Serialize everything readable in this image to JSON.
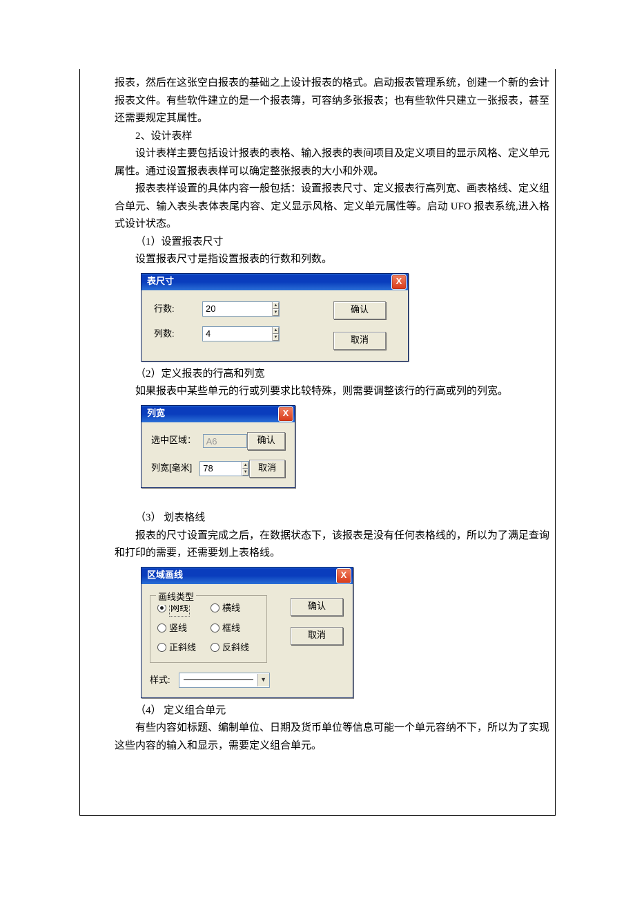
{
  "text": {
    "p1": "报表，然后在这张空白报表的基础之上设计报表的格式。启动报表管理系统，创建一个新的会计报表文件。有些软件建立的是一个报表簿，可容纳多张报表；也有些软件只建立一张报表，甚至还需要规定其属性。",
    "h2": "2、设计表样",
    "p2": "设计表样主要包括设计报表的表格、输入报表的表间项目及定义项目的显示风格、定义单元属性。通过设置报表表样可以确定整张报表的大小和外观。",
    "p3": "报表表样设置的具体内容一般包括：设置报表尺寸、定义报表行高列宽、画表格线、定义组合单元、输入表头表体表尾内容、定义显示风格、定义单元属性等。启动 UFO 报表系统,进入格式设计状态。",
    "s1": "（1）设置报表尺寸",
    "p4": "设置报表尺寸是指设置报表的行数和列数。",
    "s2": "（2）定义报表的行高和列宽",
    "p5": "如果报表中某些单元的行或列要求比较特殊，则需要调整该行的行高或列的列宽。",
    "s3": "（3） 划表格线",
    "p6": "报表的尺寸设置完成之后，在数据状态下，该报表是没有任何表格线的，所以为了满足查询和打印的需要，还需要划上表格线。",
    "s4": "（4） 定义组合单元",
    "p7": "有些内容如标题、编制单位、日期及货币单位等信息可能一个单元容纳不下，所以为了实现这些内容的输入和显示，需要定义组合单元。"
  },
  "dialog1": {
    "title": "表尺寸",
    "rows_label": "行数:",
    "rows_value": "20",
    "cols_label": "列数:",
    "cols_value": "4",
    "ok": "确认",
    "cancel": "取消"
  },
  "dialog2": {
    "title": "列宽",
    "range_label": "选中区域：",
    "range_value": "A6",
    "width_label": "列宽[毫米]",
    "width_value": "78",
    "ok": "确认",
    "cancel": "取消"
  },
  "dialog3": {
    "title": "区域画线",
    "group_label": "画线类型",
    "options": {
      "grid": "网线",
      "horiz": "横线",
      "vert": "竖线",
      "frame": "框线",
      "fwdslash": "正斜线",
      "backslash": "反斜线"
    },
    "style_label": "样式:",
    "ok": "确认",
    "cancel": "取消"
  },
  "close_x": "X"
}
